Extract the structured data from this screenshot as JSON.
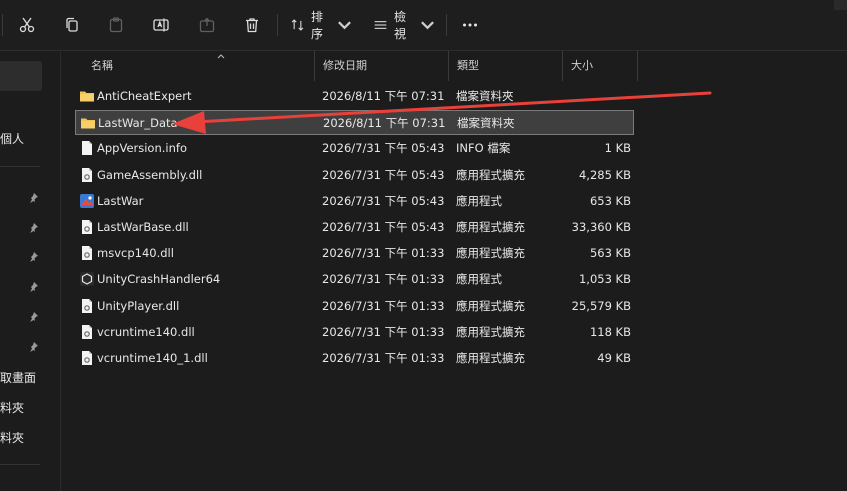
{
  "toolbar": {
    "sort_label": "排序",
    "view_label": "檢視"
  },
  "nav": {
    "items": [
      {
        "label": "個人"
      },
      {
        "label": "取畫面"
      },
      {
        "label": "料夾"
      },
      {
        "label": "料夾"
      }
    ]
  },
  "columns": {
    "name": "名稱",
    "date": "修改日期",
    "type": "類型",
    "size": "大小"
  },
  "files": [
    {
      "name": "AntiCheatExpert",
      "date": "2026/8/11 下午 07:31",
      "type": "檔案資料夾",
      "size": "",
      "icon": "folder-icon"
    },
    {
      "name": "LastWar_Data",
      "date": "2026/8/11 下午 07:31",
      "type": "檔案資料夾",
      "size": "",
      "icon": "folder-icon",
      "selected": true
    },
    {
      "name": "AppVersion.info",
      "date": "2026/7/31 下午 05:43",
      "type": "INFO 檔案",
      "size": "1 KB",
      "icon": "file-icon"
    },
    {
      "name": "GameAssembly.dll",
      "date": "2026/7/31 下午 05:43",
      "type": "應用程式擴充",
      "size": "4,285 KB",
      "icon": "dll-icon"
    },
    {
      "name": "LastWar",
      "date": "2026/7/31 下午 05:43",
      "type": "應用程式",
      "size": "653 KB",
      "icon": "app-icon"
    },
    {
      "name": "LastWarBase.dll",
      "date": "2026/7/31 下午 05:43",
      "type": "應用程式擴充",
      "size": "33,360 KB",
      "icon": "dll-icon"
    },
    {
      "name": "msvcp140.dll",
      "date": "2026/7/31 下午 01:33",
      "type": "應用程式擴充",
      "size": "563 KB",
      "icon": "dll-icon"
    },
    {
      "name": "UnityCrashHandler64",
      "date": "2026/7/31 下午 01:33",
      "type": "應用程式",
      "size": "1,053 KB",
      "icon": "unity-icon"
    },
    {
      "name": "UnityPlayer.dll",
      "date": "2026/7/31 下午 01:33",
      "type": "應用程式擴充",
      "size": "25,579 KB",
      "icon": "dll-icon"
    },
    {
      "name": "vcruntime140.dll",
      "date": "2026/7/31 下午 01:33",
      "type": "應用程式擴充",
      "size": "118 KB",
      "icon": "dll-icon"
    },
    {
      "name": "vcruntime140_1.dll",
      "date": "2026/7/31 下午 01:33",
      "type": "應用程式擴充",
      "size": "49 KB",
      "icon": "dll-icon"
    }
  ],
  "colors": {
    "folder": "#f2c14e",
    "arrow": "#e8403a",
    "selection": "#3f3f3f"
  }
}
